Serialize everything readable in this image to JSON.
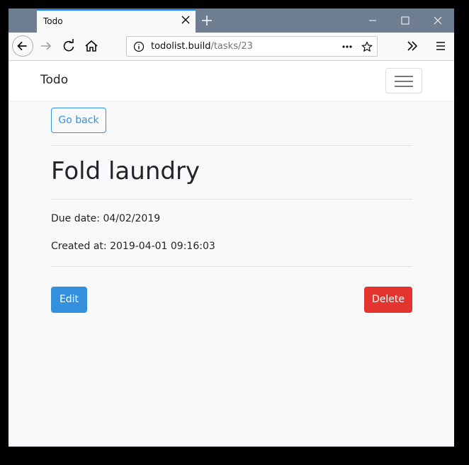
{
  "browser": {
    "tab_title": "Todo",
    "url_host": "todolist.build",
    "url_path": "/tasks/23"
  },
  "navbar": {
    "brand": "Todo"
  },
  "task": {
    "go_back_label": "Go back",
    "title": "Fold laundry",
    "due_date": "Due date: 04/02/2019",
    "created_at": "Created at: 2019-04-01 09:16:03",
    "edit_label": "Edit",
    "delete_label": "Delete"
  },
  "colors": {
    "primary": "#3490dc",
    "danger": "#e3342f",
    "tabbar": "#6f7d91"
  }
}
